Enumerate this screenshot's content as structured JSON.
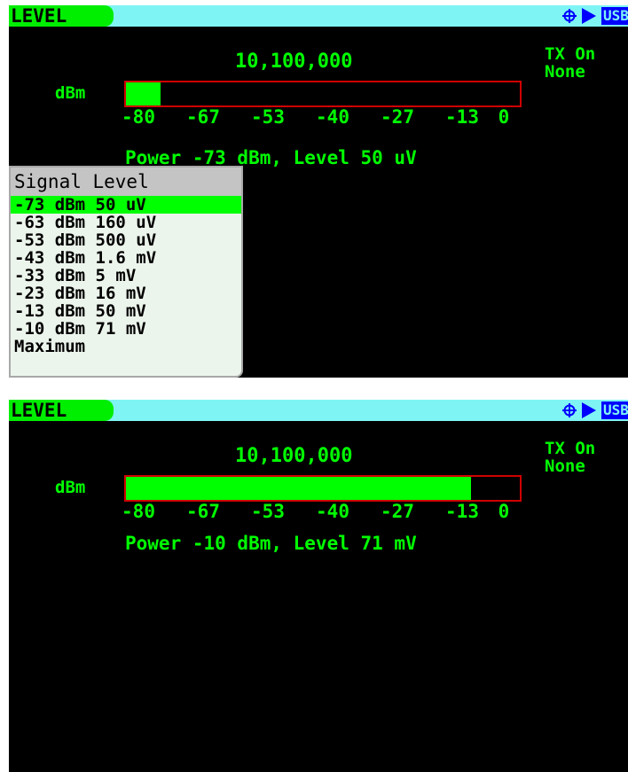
{
  "top": {
    "title": "LEVEL",
    "usb": "USB",
    "frequency": "10,100,000",
    "tx_line1": "TX On",
    "tx_line2": "None",
    "meter_unit": "dBm",
    "meter_fill_fraction": 0.087,
    "scale": [
      "-80",
      "-67",
      "-53",
      "-40",
      "-27",
      "-13",
      "0"
    ],
    "readout": "Power -73 dBm, Level 50 uV",
    "menu": {
      "title": "Signal Level",
      "selected_index": 0,
      "items": [
        "-73 dBm 50 uV",
        "-63 dBm 160 uV",
        "-53 dBm 500 uV",
        "-43 dBm 1.6 mV",
        "-33 dBm 5 mV",
        "-23 dBm 16 mV",
        "-13 dBm 50 mV",
        "-10 dBm 71 mV",
        "Maximum"
      ]
    }
  },
  "bottom": {
    "title": "LEVEL",
    "usb": "USB",
    "frequency": "10,100,000",
    "tx_line1": "TX On",
    "tx_line2": "None",
    "meter_unit": "dBm",
    "meter_fill_fraction": 0.875,
    "scale": [
      "-80",
      "-67",
      "-53",
      "-40",
      "-27",
      "-13",
      "0"
    ],
    "readout": "Power -10 dBm, Level 71 mV"
  },
  "colors": {
    "titlebar": "#7ff4f4",
    "title_tab": "#00ee00",
    "text_green": "#00ff00",
    "meter_border": "#d00000",
    "icon_blue": "#0000ff",
    "menu_bg": "#ecf5ec",
    "menu_selected": "#00ff00"
  },
  "icons": [
    "crosshair-icon",
    "play-icon"
  ]
}
